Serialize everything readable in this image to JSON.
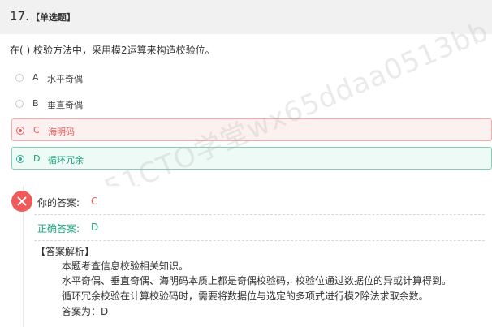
{
  "question": {
    "number": "17.",
    "type": "【单选题】",
    "stem": "在( ) 校验方法中，采用模2运算来构造校验位。"
  },
  "options": [
    {
      "letter": "A",
      "text": "水平奇偶",
      "state": "none"
    },
    {
      "letter": "B",
      "text": "垂直奇偶",
      "state": "none"
    },
    {
      "letter": "C",
      "text": "海明码",
      "state": "wrong"
    },
    {
      "letter": "D",
      "text": "循环冗余",
      "state": "correct"
    }
  ],
  "result": {
    "your_answer_label": "你的答案:",
    "your_answer_value": "C",
    "correct_answer_label": "正确答案:",
    "correct_answer_value": "D"
  },
  "analysis": {
    "title": "【答案解析】",
    "lines": [
      "本题考查信息校验相关知识。",
      "水平奇偶、垂直奇偶、海明码本质上都是奇偶校验码，校验位通过数据位的异或计算得到。",
      "循环冗余校验在计算校验码时，需要将数据位与选定的多项式进行模2除法求取余数。",
      "答案为：D"
    ]
  },
  "watermark": "51CTO学堂wx65ddaa0513bb",
  "colors": {
    "wrong": "#e85d5d",
    "correct": "#1fa37c",
    "header_bg": "#f1f1f1"
  }
}
